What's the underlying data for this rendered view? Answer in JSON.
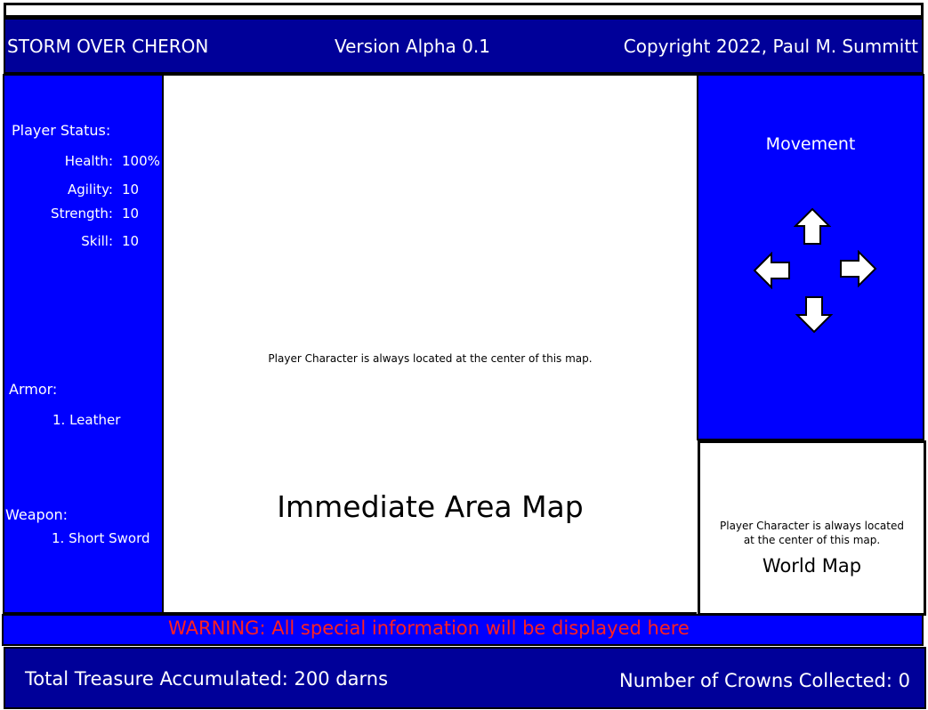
{
  "header": {
    "game_title": "STORM OVER CHERON",
    "version": "Version Alpha 0.1",
    "copyright": "Copyright 2022, Paul M. Summitt"
  },
  "player_status": {
    "title": "Player Status:",
    "stats": [
      {
        "label": "Health:",
        "value": "100%"
      },
      {
        "label": "Agility:",
        "value": "10"
      },
      {
        "label": "Strength:",
        "value": "10"
      },
      {
        "label": "Skill:",
        "value": "10"
      }
    ]
  },
  "armor": {
    "title": "Armor:",
    "items": [
      "1. Leather"
    ]
  },
  "weapon": {
    "title": "Weapon:",
    "items": [
      "1. Short Sword"
    ]
  },
  "immediate_map": {
    "note": "Player Character is always located at the center of this map.",
    "title": "Immediate Area Map"
  },
  "movement": {
    "title": "Movement",
    "icons": [
      "arrow-up-icon",
      "arrow-left-icon",
      "arrow-right-icon",
      "arrow-down-icon"
    ]
  },
  "world_map": {
    "note_line1": "Player Character is always located",
    "note_line2": "at the center of this map.",
    "title": "World Map"
  },
  "warning": {
    "text": "WARNING: All special information will be displayed here"
  },
  "footer": {
    "treasure": "Total Treasure Accumulated:  200 darns",
    "crowns": "Number of Crowns Collected:  0"
  },
  "colors": {
    "dark_blue": "#000099",
    "bright_blue": "#0000ff",
    "warning_red": "#ff2020"
  }
}
